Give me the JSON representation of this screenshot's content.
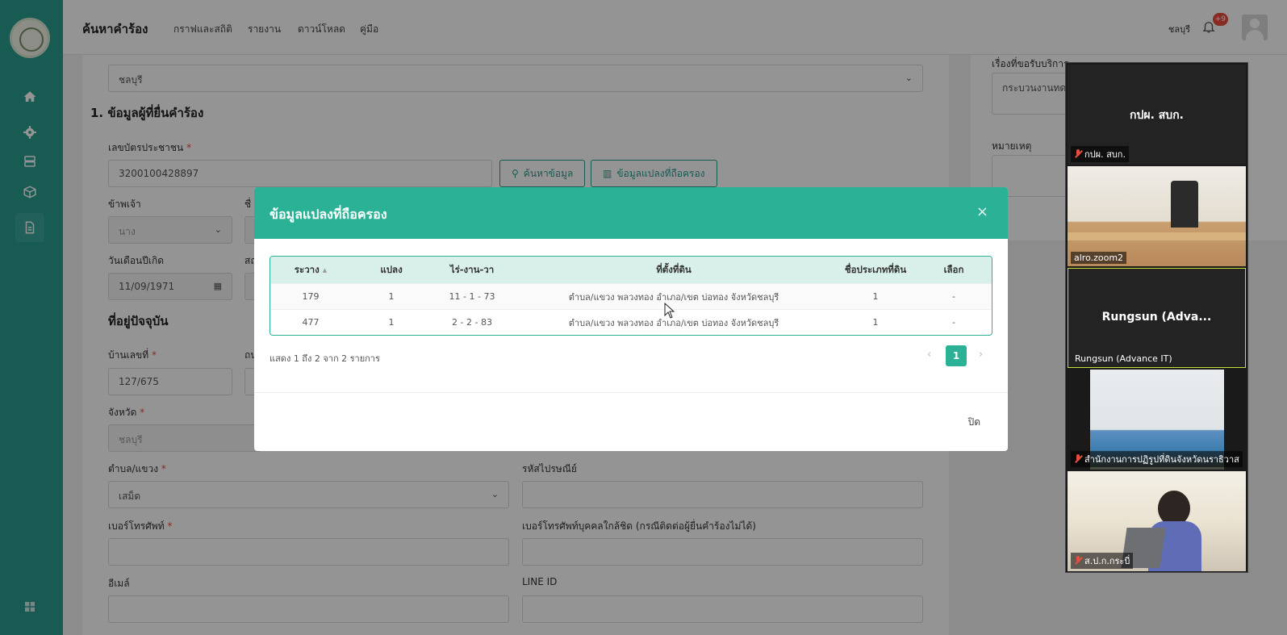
{
  "header": {
    "title": "ค้นหาคำร้อง",
    "nav": [
      "กราฟและสถิติ",
      "รายงาน",
      "ดาวน์โหลด",
      "คู่มือ"
    ],
    "user_location": "ชลบุรี",
    "notification_count": "+9"
  },
  "form": {
    "province_select_value": "ชลบุรี",
    "section1_title": "1.   ข้อมูลผู้ที่ยื่นคำร้อง",
    "id_card_label": "เลขบัตรประชาชน",
    "id_card_value": "3200100428897",
    "search_button": "ค้นหาข้อมูล",
    "plot_button": "ข้อมูลแปลงที่ถือครอง",
    "title_label": "ข้าพเจ้า",
    "title_value": "นาง",
    "col2_label_fragment": "ชื่",
    "birthdate_label": "วันเดือนปีเกิด",
    "birthdate_value": "11/09/1971",
    "col2b_label_fragment": "สถ",
    "address_title": "ที่อยู่ปัจจุบัน",
    "house_no_label": "บ้านเลขที่",
    "house_no_value": "127/675",
    "col2c_label_fragment": "ถน",
    "province_label": "จังหวัด",
    "province_value": "ชลบุรี",
    "subdistrict_label": "ตำบล/แขวง",
    "subdistrict_value": "เสม็ด",
    "postal_label": "รหัสไปรษณีย์",
    "phone_label": "เบอร์โทรศัพท์",
    "close_phone_label": "เบอร์โทรศัพท์บุคคลใกล้ชิด (กรณีติดต่อผู้ยื่นคำร้องไม่ได้)",
    "email_label": "อีเมล์",
    "line_label": "LINE ID",
    "required_mark": "*"
  },
  "side_panel": {
    "service_label": "เรื่องที่ขอรับบริการ",
    "service_value": "กระบวนงานทดส",
    "note_label": "หมายเหตุ"
  },
  "modal": {
    "title": "ข้อมูลแปลงที่ถือครอง",
    "close_icon": "×",
    "columns": [
      "ระวาง",
      "แปลง",
      "ไร่-งาน-วา",
      "ที่ตั้งที่ดิน",
      "ชื่อประเภทที่ดิน",
      "เลือก"
    ],
    "sort_indicator": "▲",
    "rows": [
      [
        "179",
        "1",
        "11 - 1 - 73",
        "ตำบล/แขวง พลวงทอง อำเภอ/เขต บ่อทอง จังหวัดชลบุรี",
        "1",
        "-"
      ],
      [
        "477",
        "1",
        "2 - 2 - 83",
        "ตำบล/แขวง พลวงทอง อำเภอ/เขต บ่อทอง จังหวัดชลบุรี",
        "1",
        "-"
      ]
    ],
    "summary": "แสดง 1 ถึง 2 จาก 2 รายการ",
    "current_page": "1",
    "prev": "‹",
    "next": "›",
    "footer_close": "ปิด"
  },
  "zoom": {
    "tiles": [
      {
        "name": "กปผ. สบก.",
        "label": "กปผ. สบก.",
        "muted": true
      },
      {
        "label": "alro.zoom2",
        "muted": false
      },
      {
        "name": "Rungsun  (Adva...",
        "label": "Rungsun (Advance IT)",
        "muted": false
      },
      {
        "label": "สำนักงานการปฏิรูปที่ดินจังหวัดนราธิวาส",
        "muted": true
      },
      {
        "label": "ส.ป.ก.กระบี่",
        "muted": true
      }
    ]
  }
}
